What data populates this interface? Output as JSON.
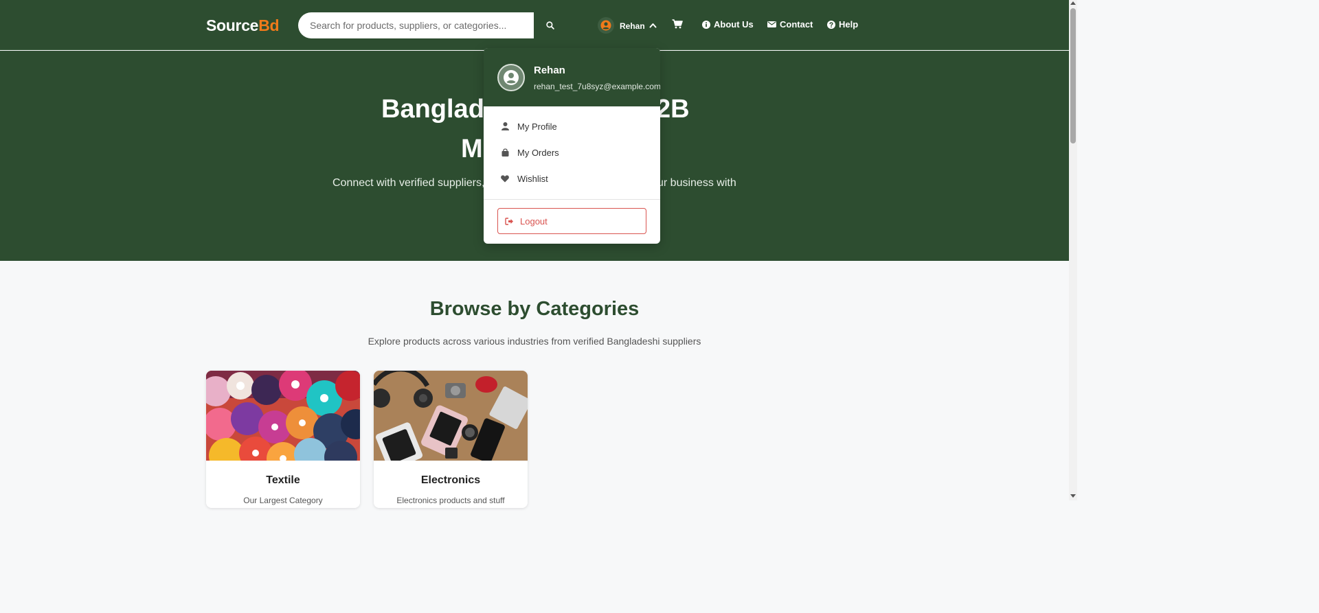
{
  "brand": {
    "name_part1": "Source",
    "name_part2": "Bd"
  },
  "search": {
    "placeholder": "Search for products, suppliers, or categories..."
  },
  "nav": {
    "user_name": "Rehan",
    "about_label": "About Us",
    "contact_label": "Contact",
    "help_label": "Help"
  },
  "hero": {
    "title_line1_left": "Banglade",
    "title_line1_right": "2B",
    "title_line2": "M",
    "subtitle_left": "Connect with verified suppliers,",
    "subtitle_right": "ur business with"
  },
  "user_dropdown": {
    "name": "Rehan",
    "email": "rehan_test_7u8syz@example.com",
    "items": [
      {
        "label": "My Profile",
        "icon": "user-icon"
      },
      {
        "label": "My Orders",
        "icon": "shopping-bag-icon"
      },
      {
        "label": "Wishlist",
        "icon": "heart-icon"
      }
    ],
    "logout_label": "Logout"
  },
  "categories": {
    "title": "Browse by Categories",
    "subtitle": "Explore products across various industries from verified Bangladeshi suppliers",
    "items": [
      {
        "name": "Textile",
        "description": "Our Largest Category"
      },
      {
        "name": "Electronics",
        "description": "Electronics products and stuff"
      }
    ]
  },
  "colors": {
    "primary": "#2d4d30",
    "accent": "#f07a1a",
    "danger": "#d9534f",
    "background": "#f7f8f9"
  }
}
